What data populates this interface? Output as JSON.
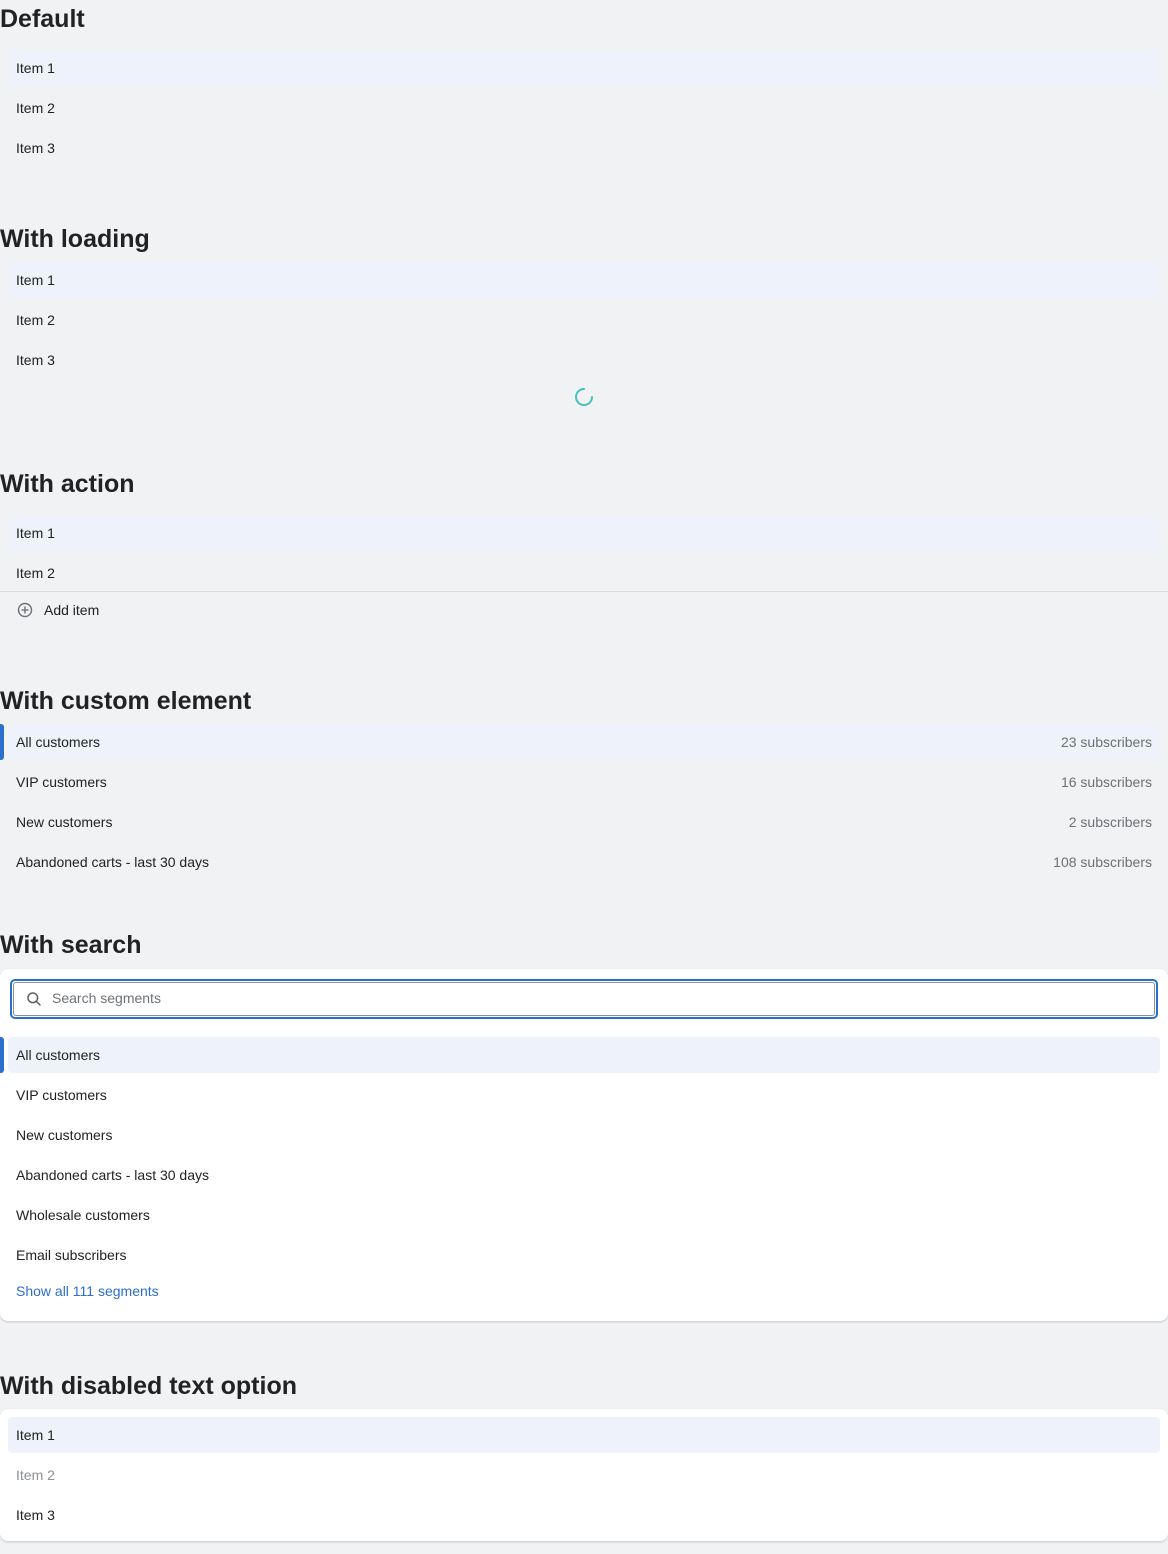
{
  "sections": {
    "default": {
      "heading": "Default",
      "items": [
        "Item 1",
        "Item 2",
        "Item 3"
      ]
    },
    "loading": {
      "heading": "With loading",
      "items": [
        "Item 1",
        "Item 2",
        "Item 3"
      ]
    },
    "action": {
      "heading": "With action",
      "items": [
        "Item 1",
        "Item 2"
      ],
      "action_label": "Add item"
    },
    "custom": {
      "heading": "With custom element",
      "items": [
        {
          "label": "All customers",
          "meta": "23 subscribers"
        },
        {
          "label": "VIP customers",
          "meta": "16 subscribers"
        },
        {
          "label": "New customers",
          "meta": "2 subscribers"
        },
        {
          "label": "Abandoned carts - last 30 days",
          "meta": "108 subscribers"
        }
      ]
    },
    "search": {
      "heading": "With search",
      "placeholder": "Search segments",
      "items": [
        "All customers",
        "VIP customers",
        "New customers",
        "Abandoned carts - last 30 days",
        "Wholesale customers",
        "Email subscribers"
      ],
      "show_all": "Show all 111 segments"
    },
    "disabled": {
      "heading": "With disabled text option",
      "items": [
        "Item 1",
        "Item 2",
        "Item 3"
      ]
    }
  },
  "colors": {
    "accent": "#2c6ecb",
    "selected_bg": "#edf2fb",
    "spinner": "#47c1bf",
    "disabled_text": "#8c9196"
  }
}
